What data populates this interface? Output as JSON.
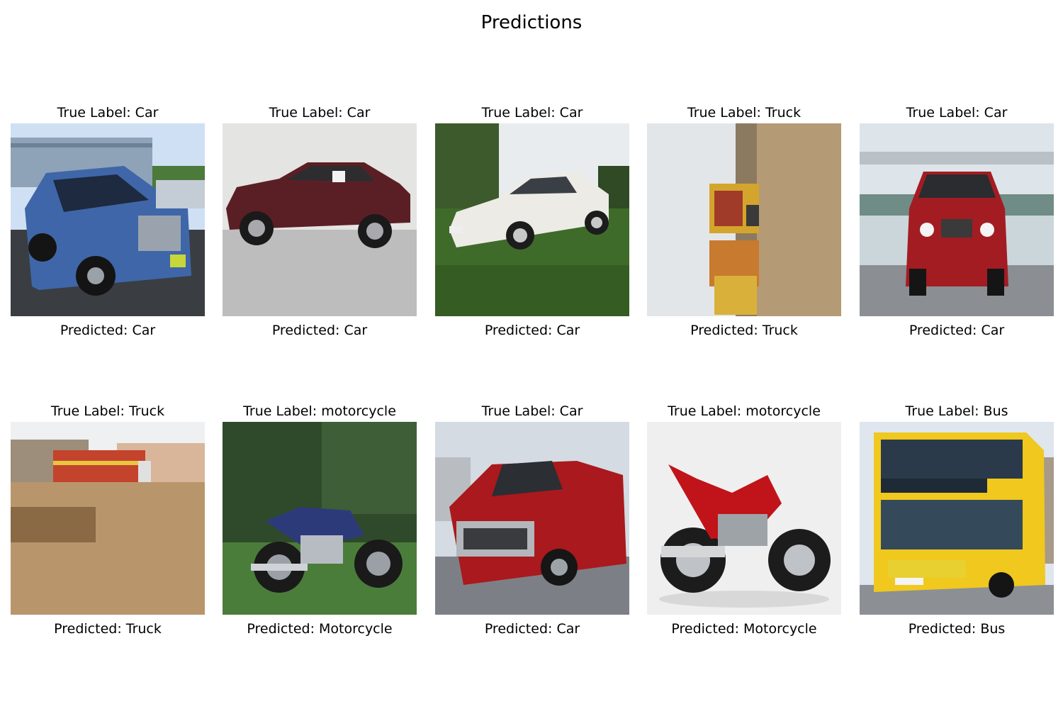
{
  "title": "Predictions",
  "panels": [
    {
      "true_label": "True Label: Car",
      "predicted": "Predicted: Car",
      "image_icon": "blue-suv-photo"
    },
    {
      "true_label": "True Label: Car",
      "predicted": "Predicted: Car",
      "image_icon": "maroon-sedan-photo"
    },
    {
      "true_label": "True Label: Car",
      "predicted": "Predicted: Car",
      "image_icon": "white-coupe-photo"
    },
    {
      "true_label": "True Label: Truck",
      "predicted": "Predicted: Truck",
      "image_icon": "rotated-trucks-photo"
    },
    {
      "true_label": "True Label: Car",
      "predicted": "Predicted: Car",
      "image_icon": "red-suv-photo"
    },
    {
      "true_label": "True Label: Truck",
      "predicted": "Predicted: Truck",
      "image_icon": "dirt-lot-truck-photo"
    },
    {
      "true_label": "True Label: motorcycle",
      "predicted": "Predicted: Motorcycle",
      "image_icon": "blue-cruiser-photo"
    },
    {
      "true_label": "True Label: Car",
      "predicted": "Predicted: Car",
      "image_icon": "red-pickup-photo"
    },
    {
      "true_label": "True Label: motorcycle",
      "predicted": "Predicted: Motorcycle",
      "image_icon": "red-sportbike-photo"
    },
    {
      "true_label": "True Label: Bus",
      "predicted": "Predicted: Bus",
      "image_icon": "yellow-double-decker-photo"
    }
  ]
}
